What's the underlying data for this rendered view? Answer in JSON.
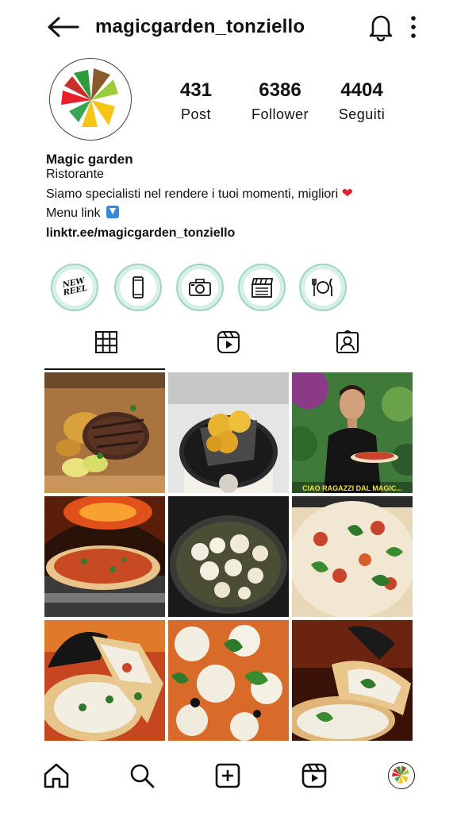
{
  "header": {
    "back_icon": "arrow-left-icon",
    "username": "magicgarden_tonziello",
    "notifications_icon": "bell-icon",
    "more_icon": "more-vertical-icon"
  },
  "profile": {
    "avatar_icon": "magic-garden-logo",
    "stats": [
      {
        "value": "431",
        "label": "Post"
      },
      {
        "value": "6386",
        "label": "Follower"
      },
      {
        "value": "4404",
        "label": "Seguiti"
      }
    ],
    "name": "Magic garden",
    "category": "Ristorante",
    "description": "Siamo specialisti nel rendere i tuoi momenti, migliori",
    "description_emoji": "❤",
    "menu_text": "Menu link",
    "menu_emoji_icon": "down-arrow-button-icon",
    "link": "linktr.ee/magicgarden_tonziello"
  },
  "highlights": [
    {
      "icon": "new-reel-icon",
      "text": "NEW REEL"
    },
    {
      "icon": "phone-icon"
    },
    {
      "icon": "camera-icon"
    },
    {
      "icon": "clapperboard-icon"
    },
    {
      "icon": "cutlery-icon"
    }
  ],
  "tabs": [
    {
      "icon": "grid-icon",
      "active": true
    },
    {
      "icon": "reels-icon",
      "active": false
    },
    {
      "icon": "tagged-icon",
      "active": false
    }
  ],
  "posts": [
    {
      "subject": "steak-with-potatoes-photo"
    },
    {
      "subject": "fried-balls-basket-photo"
    },
    {
      "subject": "chef-with-pizza-photo",
      "caption": "CIAO RAGAZZI DAL MAGIC..."
    },
    {
      "subject": "pizza-oven-photo"
    },
    {
      "subject": "pan-mozzarella-photo"
    },
    {
      "subject": "pizza-topping-photo"
    },
    {
      "subject": "pizza-slice-gloves-photo"
    },
    {
      "subject": "pizza-closeup-photo"
    },
    {
      "subject": "pizza-crust-photo"
    }
  ],
  "bottom_nav": [
    {
      "icon": "home-icon"
    },
    {
      "icon": "search-icon"
    },
    {
      "icon": "add-post-icon"
    },
    {
      "icon": "reels-icon"
    },
    {
      "icon": "profile-avatar-icon"
    }
  ],
  "colors": {
    "highlight_ring": "#9ed6c1",
    "highlight_fill": "#d6f0e6",
    "heart": "#e0202c"
  }
}
